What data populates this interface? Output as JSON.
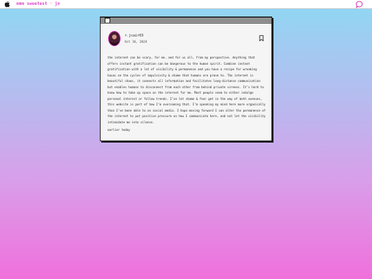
{
  "menubar": {
    "apple_icon": "apple-logo-icon",
    "title": "mmm sweetest ♡ jo",
    "chat_icon": "chat-bubble-icon",
    "accent_color": "#e03cc8"
  },
  "post": {
    "username": "r.jcair03",
    "date": "Oct 16, 2024",
    "bookmark_icon": "bookmark-icon",
    "text": "the internet can be scary, for me. and for us all, from my perspective. Anything that offers instant gratification can be dangerous to the human spirit. Combine instant gratification with a lot of visibility & permanence and you have a recipe for wreaking havoc on the cycles of impulsivity & shame that humans are prone to. The internet is beautiful chaos, it connects all information and facilitates long-distance communication but enables humans to disconnect from each other from behind private screens. It’s hard to know how to take up space on the internet for me. Most people seem to either indulge personal interest or follow trends. I’ve let shame & fear get in the way of both avenues, this website is part of how I’m overcoming that. I’m speaking my mind here more organically than I’ve been able to on social media. I hope moving forward I can alter the permanence of the internet to put positive pressure on how I communicate here, and not let the visibility intimidate me into silence.",
    "footer": "earlier today"
  }
}
